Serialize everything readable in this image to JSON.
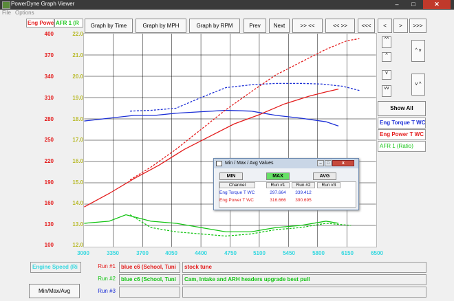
{
  "window": {
    "title": "PowerDyne Graph Viewer",
    "minimize": "–",
    "maximize": "□",
    "close": "✕"
  },
  "menu": {
    "file": "File",
    "options": "Options"
  },
  "axes_headers": {
    "left": "Eng Powe",
    "right": "AFR 1 (R"
  },
  "toolbar": [
    {
      "id": "graph-by-time",
      "label": "Graph by Time"
    },
    {
      "id": "graph-by-mph",
      "label": "Graph by MPH"
    },
    {
      "id": "graph-by-rpm",
      "label": "Graph by RPM"
    },
    {
      "id": "prev",
      "label": "Prev"
    },
    {
      "id": "next",
      "label": "Next"
    },
    {
      "id": "zoom-in",
      "label": ">> <<"
    },
    {
      "id": "zoom-out",
      "label": "<< >>"
    },
    {
      "id": "first",
      "label": "<<<"
    },
    {
      "id": "back",
      "label": "<"
    },
    {
      "id": "forward",
      "label": ">"
    },
    {
      "id": "last",
      "label": ">>>"
    }
  ],
  "side_controls": {
    "show_all": "Show All",
    "up": "^",
    "down": "v",
    "up_fast": "^^",
    "down_fast": "vv",
    "expand": "^ v",
    "collapse": "v ^"
  },
  "legend": [
    {
      "label": "Eng Torque T WC",
      "color": "#1c2fd6"
    },
    {
      "label": "Eng Power T WC",
      "color": "#e41d1d"
    },
    {
      "label": "AFR 1 (Ratio)",
      "color": "#14c414"
    }
  ],
  "dialog": {
    "title": "Min / Max / Avg Values",
    "min": "MIN",
    "max": "MAX",
    "avg": "AVG",
    "columns": [
      "Channel",
      "Run #1",
      "Run #2",
      "Run #3"
    ],
    "rows": [
      {
        "channel": "Eng Torque T WC",
        "run1": "297.664",
        "run2": "339.412",
        "run3": "",
        "color": "#1c2fd6"
      },
      {
        "channel": "Eng Power T WC",
        "run1": "316.666",
        "run2": "390.695",
        "run3": "",
        "color": "#e41d1d"
      }
    ]
  },
  "bottom": {
    "x_channel": "Engine Speed (Ri",
    "min_max_avg": "Min/Max/Avg",
    "runs": [
      {
        "label": "Run #1",
        "car": "blue c6 (School, Tuni",
        "note": "stock tune",
        "color": "#e41d1d"
      },
      {
        "label": "Run #2",
        "car": "blue c6 (School, Tuni",
        "note": "Cam, Intake and ARH headers upgrade best pull",
        "color": "#14c414"
      },
      {
        "label": "Run #3",
        "car": "",
        "note": "",
        "color": "#1c2fd6"
      }
    ]
  },
  "colors": {
    "power": "#e41d1d",
    "torque": "#1c2fd6",
    "afr": "#14c414",
    "afr_axis": "#b8ba2a",
    "x_axis": "#35d8e0"
  },
  "chart_data": {
    "type": "line",
    "xlabel": "Engine Speed (Ri",
    "xlim": [
      3000,
      6500
    ],
    "x_ticks": [
      "3000",
      "3350",
      "3700",
      "4050",
      "4400",
      "4750",
      "5100",
      "5450",
      "5800",
      "6150",
      "6500"
    ],
    "y_left_ticks": [
      "400",
      "370",
      "340",
      "310",
      "280",
      "250",
      "220",
      "190",
      "160",
      "130",
      "100"
    ],
    "y_right_ticks": [
      "22.0",
      "21.0",
      "20.0",
      "19.0",
      "18.0",
      "17.0",
      "16.0",
      "15.0",
      "14.0",
      "13.0",
      "12.0"
    ],
    "ylim_left": [
      100,
      400
    ],
    "ylim_right": [
      12.0,
      22.0
    ],
    "series": [
      {
        "name": "Eng Torque T WC",
        "run": 1,
        "axis": "left",
        "color": "#1c2fd6",
        "dash": false,
        "x": [
          3000,
          3300,
          3600,
          3850,
          4100,
          4400,
          4700,
          5000,
          5300,
          5600,
          5900,
          6050
        ],
        "y": [
          277,
          281,
          285,
          285,
          288,
          290,
          292,
          291,
          285,
          281,
          276,
          270
        ]
      },
      {
        "name": "Eng Torque T WC",
        "run": 2,
        "axis": "left",
        "color": "#1c2fd6",
        "dash": true,
        "x": [
          3550,
          3800,
          4100,
          4400,
          4700,
          5000,
          5300,
          5600,
          5850,
          6100,
          6300
        ],
        "y": [
          291,
          292,
          295,
          310,
          324,
          328,
          330,
          330,
          329,
          326,
          320
        ]
      },
      {
        "name": "Eng Power T WC",
        "run": 1,
        "axis": "left",
        "color": "#e41d1d",
        "dash": false,
        "x": [
          3000,
          3300,
          3600,
          3900,
          4200,
          4500,
          4800,
          5100,
          5400,
          5700,
          5900,
          6050
        ],
        "y": [
          156,
          175,
          196,
          215,
          237,
          255,
          273,
          286,
          301,
          312,
          318,
          322
        ]
      },
      {
        "name": "Eng Power T WC",
        "run": 2,
        "axis": "left",
        "color": "#e41d1d",
        "dash": true,
        "x": [
          3550,
          3800,
          4100,
          4400,
          4700,
          5000,
          5300,
          5600,
          5900,
          6150,
          6300
        ],
        "y": [
          194,
          212,
          237,
          265,
          293,
          318,
          342,
          360,
          378,
          390,
          393
        ]
      },
      {
        "name": "AFR 1 (Ratio)",
        "run": 1,
        "axis": "right",
        "color": "#14c414",
        "dash": false,
        "x": [
          3000,
          3300,
          3500,
          3800,
          4100,
          4400,
          4700,
          5000,
          5300,
          5600,
          5900,
          6050
        ],
        "y": [
          13.1,
          13.2,
          13.5,
          13.2,
          13.1,
          12.9,
          12.7,
          12.7,
          12.9,
          13.0,
          13.2,
          13.1
        ]
      },
      {
        "name": "AFR 1 (Ratio)",
        "run": 2,
        "axis": "right",
        "color": "#14c414",
        "dash": true,
        "x": [
          3550,
          3800,
          4100,
          4400,
          4700,
          5000,
          5300,
          5600,
          5900,
          6200
        ],
        "y": [
          13.5,
          12.9,
          12.7,
          12.6,
          12.5,
          12.6,
          12.8,
          12.9,
          13.1,
          13.0
        ]
      }
    ]
  }
}
